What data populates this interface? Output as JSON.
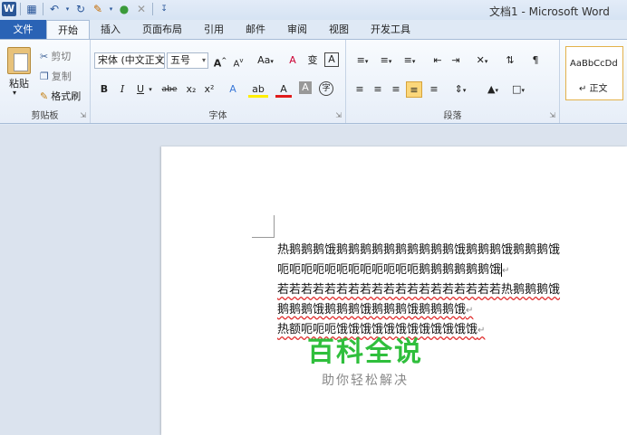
{
  "titlebar": {
    "title": "文档1 - Microsoft Word",
    "qat": [
      "W",
      "💾",
      "↶",
      "↻",
      "🖌",
      "●",
      "✎",
      "⇩"
    ]
  },
  "tabs": [
    "文件",
    "开始",
    "插入",
    "页面布局",
    "引用",
    "邮件",
    "审阅",
    "视图",
    "开发工具"
  ],
  "clipboard": {
    "paste": "粘贴",
    "cut": "剪切",
    "copy": "复制",
    "format_painter": "格式刷",
    "label": "剪贴板"
  },
  "font": {
    "font_name": "宋体 (中文正文)",
    "font_size": "五号",
    "grow": "A",
    "shrink": "A",
    "change_case": "Aa",
    "clear_format": "A",
    "bold": "B",
    "italic": "I",
    "underline": "U",
    "strike": "abe",
    "subscript": "x₂",
    "superscript": "x²",
    "text_effect": "A",
    "highlight": "ab",
    "font_color": "A",
    "char_shade": "A",
    "enclose": "字",
    "phonetic": "变",
    "char_border": "A",
    "label": "字体"
  },
  "paragraph": {
    "label": "段落"
  },
  "styles": {
    "style1": "AaBbCcDd",
    "style1_name": "↵ 正文"
  },
  "document": {
    "lines": [
      "热鹅鹅鹅饿鹅鹅鹅鹅鹅鹅鹅鹅鹅鹅饿鹅鹅鹅饿鹅鹅鹅饿",
      "呃呃呃呃呃呃呃呃呃呃呃呃鹅鹅鹅鹅鹅鹅饿",
      "若若若若若若若若若若若若若若若若若若若热鹅鹅鹅饿",
      "鹅鹅鹅饿鹅鹅鹅饿鹅鹅鹅饿鹅鹅鹅饿",
      "热额呃呃呃饿饿饿饿饿饿饿饿饿饿饿饿"
    ],
    "pilcrow": "↵"
  },
  "watermark": {
    "title": "百科全说",
    "subtitle": "助你轻松解决"
  }
}
